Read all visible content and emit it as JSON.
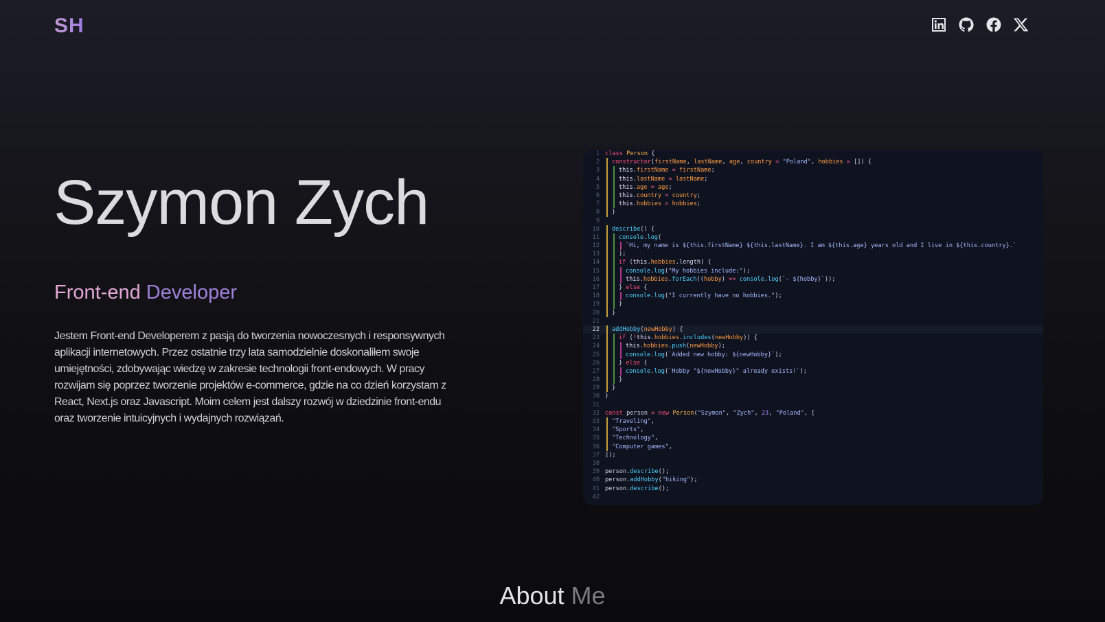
{
  "header": {
    "logo": "SH",
    "socials": [
      {
        "name": "linkedin-icon"
      },
      {
        "name": "github-icon"
      },
      {
        "name": "facebook-icon"
      },
      {
        "name": "x-icon"
      }
    ]
  },
  "hero": {
    "name": "Szymon Zych",
    "role_part1": "Front-end",
    "role_part2": "Developer",
    "description": "Jestem Front-end Developerem z pasją do tworzenia nowoczesnych i responsywnych aplikacji internetowych. Przez ostatnie trzy lata samodzielnie doskonaliłem swoje umiejętności, zdobywając wiedzę w zakresie technologii front-endowych. W pracy rozwijam się poprzez tworzenie projektów e-commerce, gdzie na co dzień korzystam z React, Next.js oraz Javascript. Moim celem jest dalszy rozwój w dziedzinie front-endu oraz tworzenie intuicyjnych i wydajnych rozwiązań."
  },
  "code": {
    "active_line": 22,
    "lines": [
      "class Person {",
      "  constructor(firstName, lastName, age, country = \"Poland\", hobbies = []) {",
      "    this.firstName = firstName;",
      "    this.lastName = lastName;",
      "    this.age = age;",
      "    this.country = country;",
      "    this.hobbies = hobbies;",
      "  }",
      "",
      "  describe() {",
      "    console.log(",
      "      `Hi, my name is ${this.firstName} ${this.lastName}. I am ${this.age} years old and I live in ${this.country}.`",
      "    );",
      "    if (this.hobbies.length) {",
      "      console.log(\"My hobbies include:\");",
      "      this.hobbies.forEach((hobby) => console.log(`- ${hobby}`));",
      "    } else {",
      "      console.log(\"I currently have no hobbies.\");",
      "    }",
      "  }",
      "",
      "  addHobby(newHobby) {",
      "    if (!this.hobbies.includes(newHobby)) {",
      "      this.hobbies.push(newHobby);",
      "      console.log(`Added new hobby: ${newHobby}`);",
      "    } else {",
      "      console.log(`Hobby \"${newHobby}\" already exists!`);",
      "    }",
      "  }",
      "}",
      "",
      "const person = new Person(\"Szymon\", \"Zych\", 23, \"Poland\", [",
      "  \"Traveling\",",
      "  \"Sports\",",
      "  \"Technology\",",
      "  \"Computer games\",",
      "]);",
      "",
      "person.describe();",
      "person.addHobby(\"hiking\");",
      "person.describe();",
      ""
    ]
  },
  "about": {
    "part1": "About",
    "part2": "Me"
  },
  "colors": {
    "logo_gradient": [
      "#c79bd6",
      "#9b7be0"
    ],
    "role_part1": "#e3a6d5",
    "role_part2": "#9e80d8",
    "code_background": "#0f1320"
  }
}
